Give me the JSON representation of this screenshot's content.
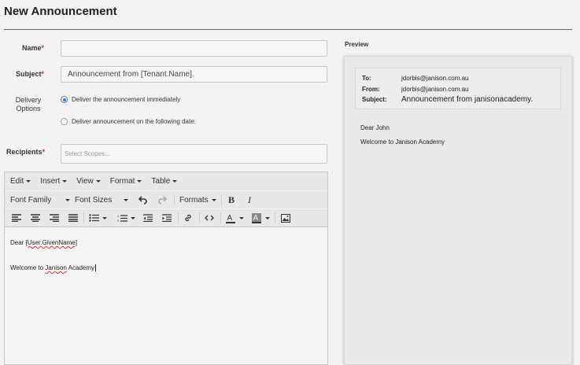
{
  "page": {
    "title": "New Announcement"
  },
  "form": {
    "name": {
      "label": "Name",
      "required_mark": "*",
      "value": ""
    },
    "subject": {
      "label": "Subject",
      "required_mark": "*",
      "value": "Announcement from [Tenant.Name]."
    },
    "delivery": {
      "label_line1": "Delivery",
      "label_line2": "Options",
      "options": [
        {
          "label": "Deliver the announcement immediately",
          "selected": true
        },
        {
          "label": "Deliver announcement on the following date:",
          "selected": false
        }
      ]
    },
    "recipients": {
      "label": "Recipients",
      "required_mark": "*",
      "placeholder": "Select Scopes..."
    }
  },
  "editor": {
    "menus": [
      "Edit",
      "Insert",
      "View",
      "Format",
      "Table"
    ],
    "toolbar": {
      "font_family": "Font Family",
      "font_sizes": "Font Sizes",
      "formats": "Formats"
    },
    "icons": [
      "undo-icon",
      "redo-icon",
      "bold-icon",
      "italic-icon",
      "align-left-icon",
      "align-center-icon",
      "align-right-icon",
      "justify-icon",
      "bullet-list-icon",
      "numbered-list-icon",
      "outdent-icon",
      "indent-icon",
      "link-icon",
      "code-icon",
      "text-color-icon",
      "background-color-icon",
      "image-icon"
    ],
    "body": {
      "line1_prefix": "Dear ",
      "line1_token": "[User.GivenName]",
      "line2_prefix": "Welcome to ",
      "line2_token": "Janison",
      "line2_suffix": " Academy"
    }
  },
  "preview": {
    "label": "Preview",
    "to_label": "To:",
    "to_value": "jdorbis@janison.com.au",
    "from_label": "From:",
    "from_value": "jdorbis@janison.com.au",
    "subject_label": "Subject:",
    "subject_value": "Announcement from janisonacademy.",
    "body_line1": "Dear John",
    "body_line2": "Welcome to Janison Academy"
  }
}
